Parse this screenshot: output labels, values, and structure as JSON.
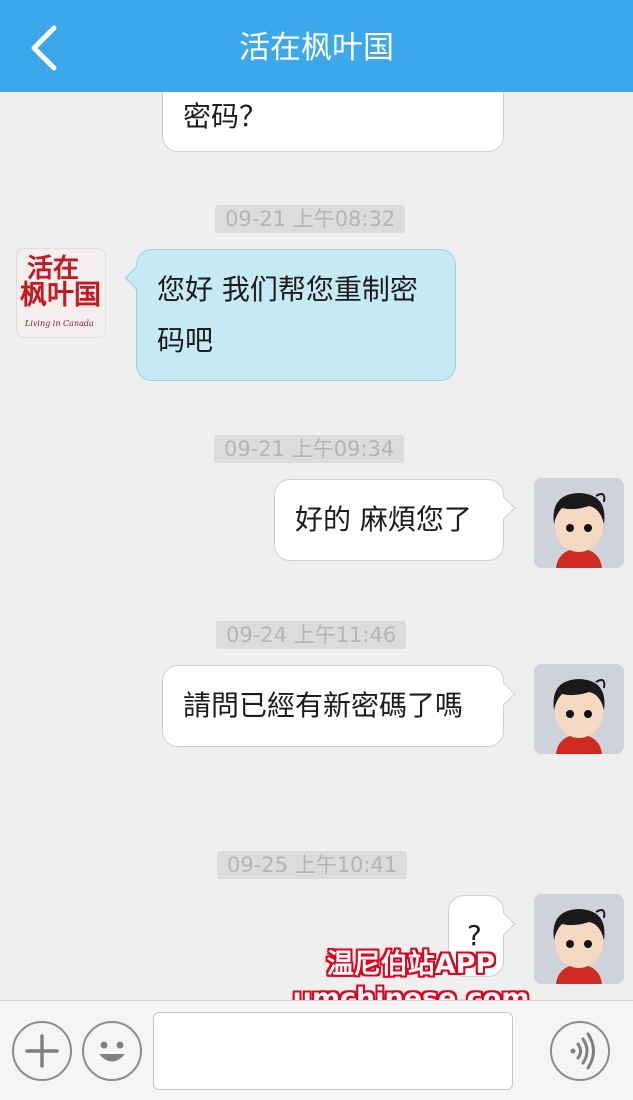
{
  "header": {
    "title": "活在枫叶国",
    "back_icon": "chevron-left-icon"
  },
  "brand_avatar": {
    "line1": "活在",
    "line2": "枫叶国",
    "sub": "Living in Canada"
  },
  "messages": [
    {
      "type": "out",
      "text": "密码？"
    },
    {
      "type": "timestamp",
      "text": "09-21 上午08:32"
    },
    {
      "type": "in",
      "lines": [
        "您好 我们帮您重制密",
        "码吧"
      ]
    },
    {
      "type": "timestamp",
      "text": "09-21 上午09:34"
    },
    {
      "type": "out",
      "text": "好的 麻煩您了"
    },
    {
      "type": "timestamp",
      "text": "09-24 上午11:46"
    },
    {
      "type": "out",
      "text": "請問已經有新密碼了嗎"
    },
    {
      "type": "timestamp",
      "text": "09-25 上午10:41"
    },
    {
      "type": "out",
      "text": "?"
    }
  ],
  "watermark": {
    "line1": "温尼伯站APP",
    "line2": "umchinese.com"
  },
  "input_bar": {
    "input_value": "",
    "input_placeholder": ""
  },
  "colors": {
    "header_bg": "#3aa8ea",
    "incoming_bubble": "#c6eaf4",
    "outgoing_bubble": "#ffffff",
    "watermark_red": "#e2001a"
  }
}
